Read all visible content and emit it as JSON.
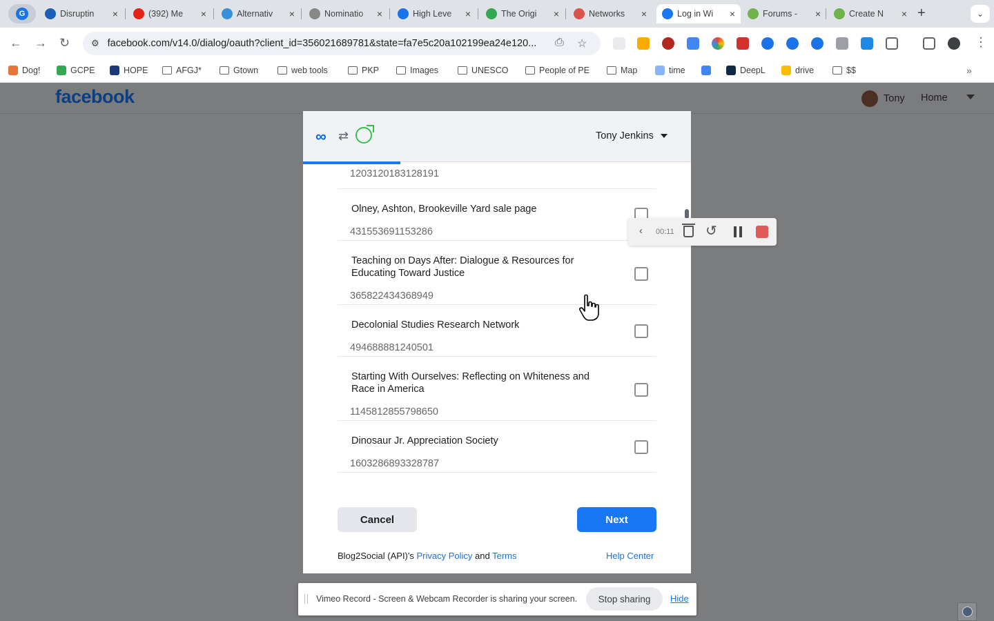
{
  "browser": {
    "tabs": [
      {
        "title": "Disruptin",
        "icon": "tab-favicon-d",
        "color": "#1b5fb8"
      },
      {
        "title": "(392) Me",
        "icon": "youtube-icon",
        "color": "#e62117"
      },
      {
        "title": "Alternativ",
        "icon": "bird-icon",
        "color": "#3a8fd6"
      },
      {
        "title": "Nominatio",
        "icon": "doc-icon",
        "color": "#888888"
      },
      {
        "title": "High Leve",
        "icon": "globe-icon",
        "color": "#1a73e8"
      },
      {
        "title": "The Origi",
        "icon": "circle-icon",
        "color": "#34a853"
      },
      {
        "title": "Networks",
        "icon": "pinwheel-icon",
        "color": "#d9534f"
      },
      {
        "title": "Log in Wi",
        "icon": "facebook-icon",
        "color": "#1877f2"
      },
      {
        "title": "Forums -",
        "icon": "leaf-icon",
        "color": "#6fb34a"
      },
      {
        "title": "Create N",
        "icon": "leaf-icon",
        "color": "#6fb34a"
      }
    ],
    "url": "facebook.com/v14.0/dialog/oauth?client_id=356021689781&state=fa7e5c20a102199ea24e120...",
    "bookmarks": [
      {
        "label": "Dog!",
        "kind": "dot",
        "color": "#e8743b"
      },
      {
        "label": "GCPE",
        "kind": "dot",
        "color": "#34a853"
      },
      {
        "label": "HOPE",
        "kind": "dot",
        "color": "#1a3a7a"
      },
      {
        "label": "AFGJ*",
        "kind": "folder"
      },
      {
        "label": "Gtown",
        "kind": "folder"
      },
      {
        "label": "web tools",
        "kind": "folder"
      },
      {
        "label": "PKP",
        "kind": "folder"
      },
      {
        "label": "Images",
        "kind": "folder"
      },
      {
        "label": "UNESCO",
        "kind": "folder"
      },
      {
        "label": "People of PE",
        "kind": "folder"
      },
      {
        "label": "Map",
        "kind": "folder"
      },
      {
        "label": "time",
        "kind": "dot",
        "color": "#8ab4f8"
      },
      {
        "label": "",
        "kind": "dot",
        "color": "#4285f4"
      },
      {
        "label": "DeepL",
        "kind": "dot",
        "color": "#0f2b46"
      },
      {
        "label": "drive",
        "kind": "dot",
        "color": "#fbbc04"
      },
      {
        "label": "$$",
        "kind": "folder"
      }
    ]
  },
  "facebook": {
    "logo": "facebook",
    "user": "Tony",
    "home": "Home"
  },
  "dialog": {
    "account_name": "Tony Jenkins",
    "progress_fraction": 0.25,
    "items": [
      {
        "name": "",
        "id": "1203120183128191"
      },
      {
        "name": "Olney, Ashton, Brookeville Yard sale page",
        "id": "431553691153286"
      },
      {
        "name": "Teaching on Days After: Dialogue & Resources for Educating Toward Justice",
        "id": "365822434368949"
      },
      {
        "name": "Decolonial Studies Research Network",
        "id": "494688881240501"
      },
      {
        "name": "Starting With Ourselves: Reflecting on Whiteness and Race in America",
        "id": "1145812855798650"
      },
      {
        "name": "Dinosaur Jr. Appreciation Society",
        "id": "1603286893328787"
      }
    ],
    "cancel_label": "Cancel",
    "next_label": "Next",
    "footer_app": "Blog2Social (API)'s ",
    "privacy_label": "Privacy Policy",
    "and_label": " and ",
    "terms_label": "Terms",
    "help_label": "Help Center"
  },
  "recorder": {
    "time": "00:11"
  },
  "sharing": {
    "message": "Vimeo Record - Screen & Webcam Recorder is sharing your screen.",
    "stop_label": "Stop sharing",
    "hide_label": "Hide"
  }
}
